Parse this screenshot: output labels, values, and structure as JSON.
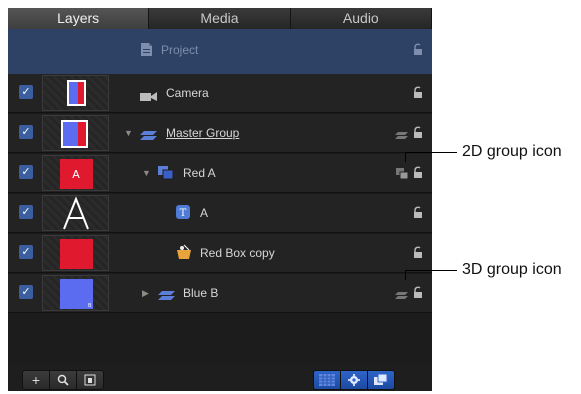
{
  "tabs": [
    {
      "label": "Layers"
    },
    {
      "label": "Media"
    },
    {
      "label": "Audio"
    }
  ],
  "project": {
    "label": "Project",
    "icon": "document-icon"
  },
  "layers": [
    {
      "name": "Camera",
      "checked": true,
      "icon": "camera-icon",
      "thumb": "camera"
    },
    {
      "name": "Master Group",
      "checked": true,
      "icon": "3d-group-icon",
      "thumb": "master",
      "disclosure": "expanded"
    },
    {
      "name": "Red  A",
      "checked": true,
      "icon": "2d-group-icon",
      "thumb": "red-a",
      "disclosure": "expanded"
    },
    {
      "name": "A",
      "checked": true,
      "icon": "text-icon",
      "thumb": "letter-a"
    },
    {
      "name": "Red Box copy",
      "checked": true,
      "icon": "shape-icon",
      "thumb": "red-box"
    },
    {
      "name": "Blue  B",
      "checked": true,
      "icon": "3d-group-icon",
      "thumb": "blue-b",
      "disclosure": "collapsed"
    }
  ],
  "footer": {
    "left_buttons": [
      "add-icon",
      "search-icon",
      "layout-icon"
    ],
    "right_buttons": [
      "checker-icon",
      "gear-icon",
      "layers-icon"
    ]
  },
  "callouts": [
    {
      "label": "2D group icon"
    },
    {
      "label": "3D group icon"
    }
  ],
  "colors": {
    "panel": "#1c1c1c",
    "selected_row": "#2e4266",
    "checkbox": "#3b5e9e",
    "red": "#e0192e",
    "blue": "#5b6cf0"
  }
}
